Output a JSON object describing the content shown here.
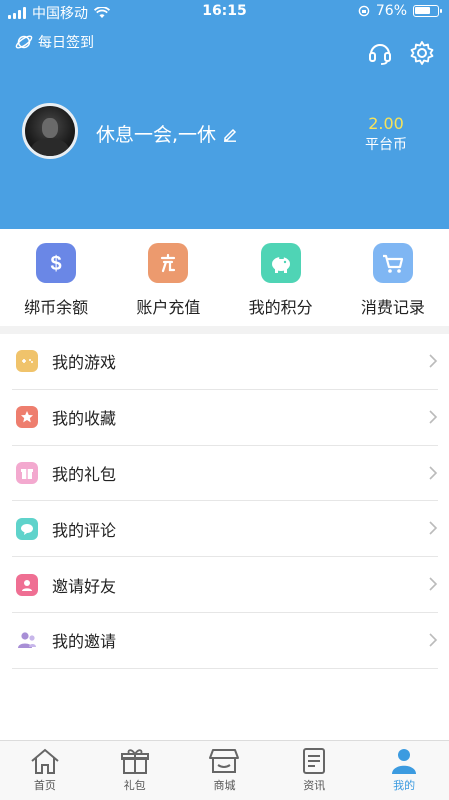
{
  "status_bar": {
    "carrier": "中国移动",
    "time": "16:15",
    "battery": "76%",
    "battery_level": 0.76
  },
  "header": {
    "checkin_label": "每日签到",
    "nickname": "休息一会,一休",
    "balance_amount": "2.00",
    "balance_label": "平台币"
  },
  "quick_actions": [
    {
      "label": "绑币余额",
      "icon": "dollar-icon",
      "color": "#6a87e6"
    },
    {
      "label": "账户充值",
      "icon": "recharge-icon",
      "color": "#ec9a6e"
    },
    {
      "label": "我的积分",
      "icon": "piggy-bank-icon",
      "color": "#4fd4b5"
    },
    {
      "label": "消费记录",
      "icon": "cart-icon",
      "color": "#7fb6f3"
    }
  ],
  "menu": [
    {
      "label": "我的游戏",
      "icon": "gamepad-icon",
      "color": "#f0c36b"
    },
    {
      "label": "我的收藏",
      "icon": "star-icon",
      "color": "#ee7e6e"
    },
    {
      "label": "我的礼包",
      "icon": "gift-icon",
      "color": "#f3a9cf"
    },
    {
      "label": "我的评论",
      "icon": "comment-icon",
      "color": "#5fd3cb"
    },
    {
      "label": "邀请好友",
      "icon": "invite-friend-icon",
      "color": "#ef6f93"
    },
    {
      "label": "我的邀请",
      "icon": "users-icon",
      "color": "#a88fd6"
    }
  ],
  "tabs": [
    {
      "label": "首页",
      "icon": "home-icon",
      "active": false
    },
    {
      "label": "礼包",
      "icon": "gift-icon",
      "active": false
    },
    {
      "label": "商城",
      "icon": "store-icon",
      "active": false
    },
    {
      "label": "资讯",
      "icon": "news-icon",
      "active": false
    },
    {
      "label": "我的",
      "icon": "user-icon",
      "active": true
    }
  ],
  "colors": {
    "header_bg": "#4aa0e3",
    "balance_amount": "#f7e35a",
    "tab_active": "#3c9be0"
  }
}
